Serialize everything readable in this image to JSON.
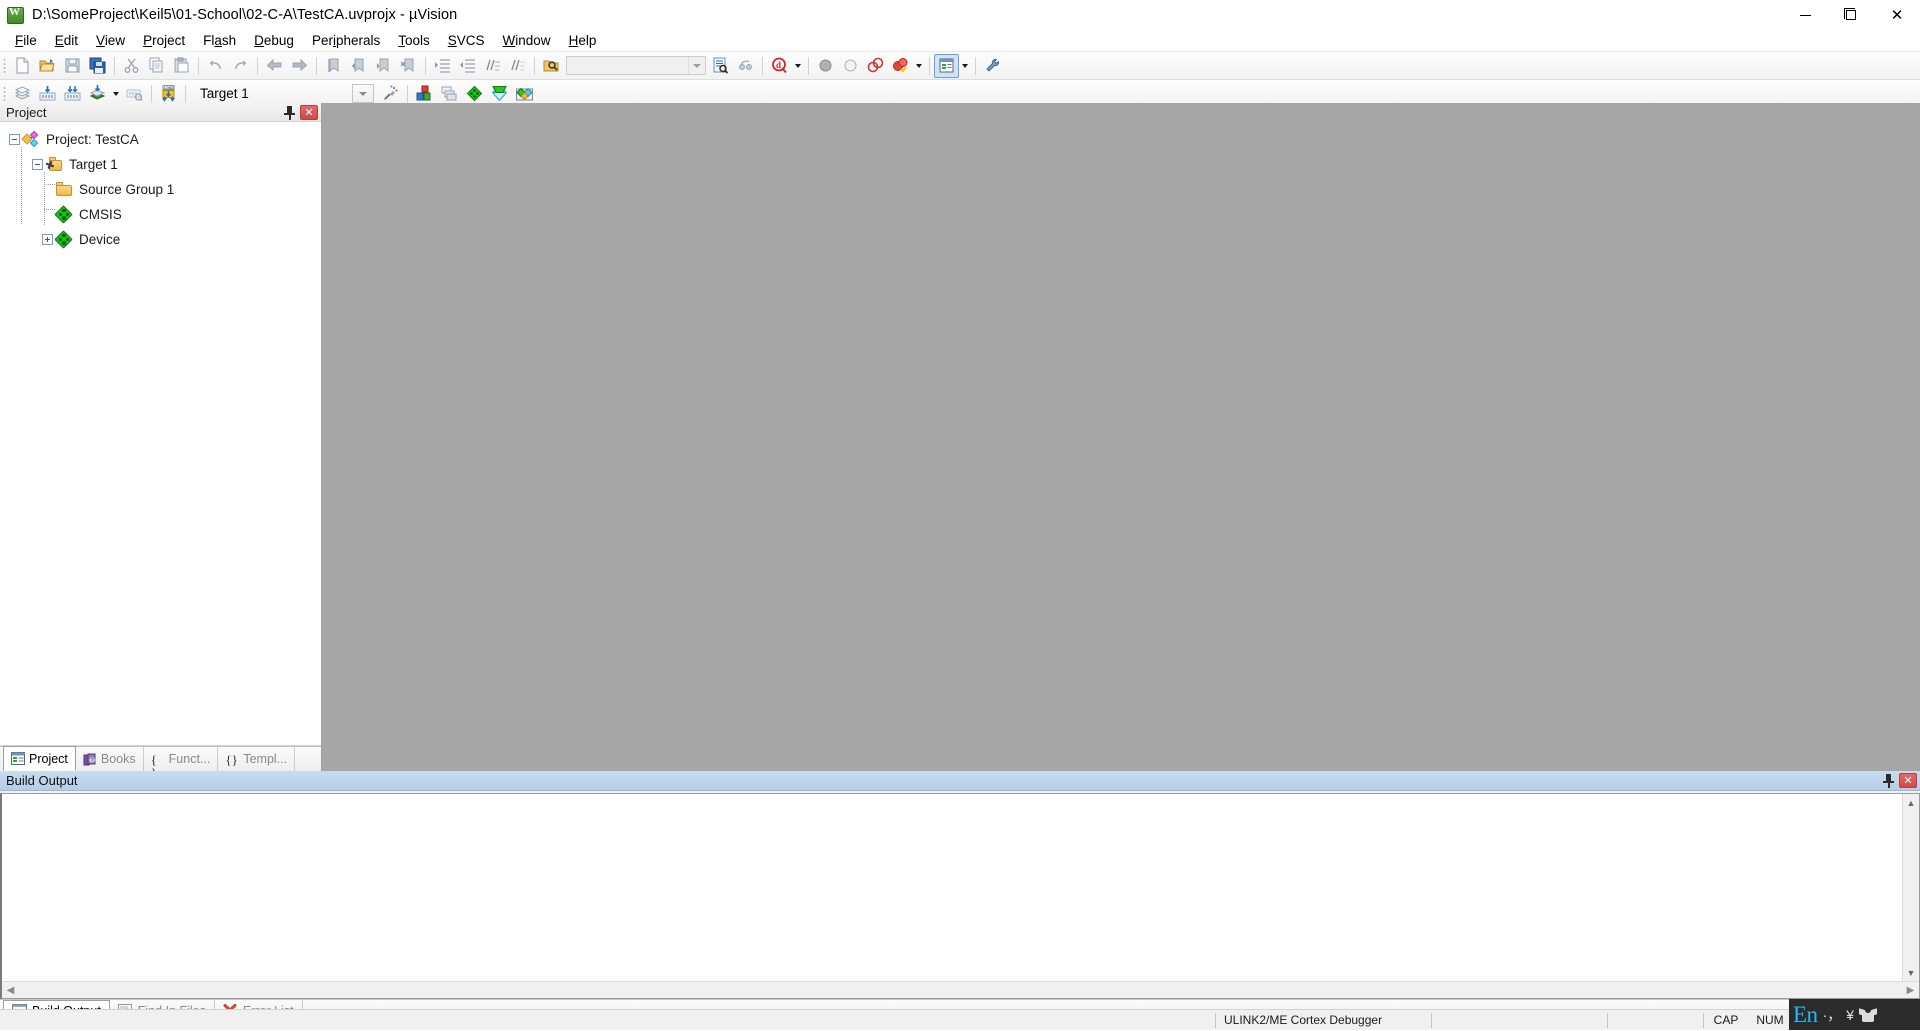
{
  "window": {
    "title": "D:\\SomeProject\\Keil5\\01-School\\02-C-A\\TestCA.uvprojx - µVision",
    "app_icon": "uvision-icon",
    "minimize_label": "Minimize",
    "maximize_label": "Maximize",
    "close_label": "Close"
  },
  "menubar": {
    "items": [
      {
        "label": "File",
        "accel": "F"
      },
      {
        "label": "Edit",
        "accel": "E"
      },
      {
        "label": "View",
        "accel": "V"
      },
      {
        "label": "Project",
        "accel": "P"
      },
      {
        "label": "Flash",
        "accel": "a"
      },
      {
        "label": "Debug",
        "accel": "D"
      },
      {
        "label": "Peripherals",
        "accel": "i"
      },
      {
        "label": "Tools",
        "accel": "T"
      },
      {
        "label": "SVCS",
        "accel": "S"
      },
      {
        "label": "Window",
        "accel": "W"
      },
      {
        "label": "Help",
        "accel": "H"
      }
    ]
  },
  "toolbar_file": {
    "buttons": [
      {
        "name": "new-file-icon",
        "tooltip": "New"
      },
      {
        "name": "open-file-icon",
        "tooltip": "Open"
      },
      {
        "name": "save-icon",
        "tooltip": "Save"
      },
      {
        "name": "save-all-icon",
        "tooltip": "Save All"
      },
      {
        "name": "cut-icon",
        "tooltip": "Cut"
      },
      {
        "name": "copy-icon",
        "tooltip": "Copy"
      },
      {
        "name": "paste-icon",
        "tooltip": "Paste"
      },
      {
        "name": "undo-icon",
        "tooltip": "Undo"
      },
      {
        "name": "redo-icon",
        "tooltip": "Redo"
      },
      {
        "name": "navigate-back-icon",
        "tooltip": "Back"
      },
      {
        "name": "navigate-forward-icon",
        "tooltip": "Forward"
      },
      {
        "name": "bookmark-toggle-icon",
        "tooltip": "Insert/Remove Bookmark"
      },
      {
        "name": "bookmark-prev-icon",
        "tooltip": "Previous Bookmark"
      },
      {
        "name": "bookmark-next-icon",
        "tooltip": "Next Bookmark"
      },
      {
        "name": "bookmark-clear-icon",
        "tooltip": "Clear All Bookmarks"
      },
      {
        "name": "indent-icon",
        "tooltip": "Indent Selected Lines"
      },
      {
        "name": "outdent-icon",
        "tooltip": "Unindent Selected Lines"
      },
      {
        "name": "comment-icon",
        "tooltip": "Comment Selection"
      },
      {
        "name": "uncomment-icon",
        "tooltip": "Uncomment Selection"
      },
      {
        "name": "find-in-files-icon",
        "tooltip": "Find in Files"
      }
    ],
    "search_box": {
      "value": "",
      "placeholder": ""
    },
    "after_search": [
      {
        "name": "find-next-icon",
        "tooltip": "Find Next"
      },
      {
        "name": "incremental-find-icon",
        "tooltip": "Incremental Find"
      },
      {
        "name": "debug-session-icon",
        "tooltip": "Start/Stop Debug Session"
      }
    ],
    "debug_buttons": [
      {
        "name": "insert-breakpoint-icon",
        "tooltip": "Insert/Remove Breakpoint"
      },
      {
        "name": "disable-breakpoint-icon",
        "tooltip": "Enable/Disable Breakpoint"
      },
      {
        "name": "disable-all-breakpoints-icon",
        "tooltip": "Disable All Breakpoints"
      },
      {
        "name": "kill-all-breakpoints-icon",
        "tooltip": "Kill All Breakpoints"
      }
    ],
    "window_button": {
      "name": "configure-toolbox-icon",
      "tooltip": "Configuration Wizard",
      "active": true
    },
    "utilities_button": {
      "name": "wrench-icon",
      "tooltip": "Utilities"
    }
  },
  "toolbar_build": {
    "buttons": [
      {
        "name": "translate-icon",
        "tooltip": "Translate"
      },
      {
        "name": "build-icon",
        "tooltip": "Build"
      },
      {
        "name": "rebuild-icon",
        "tooltip": "Rebuild"
      },
      {
        "name": "batch-build-icon",
        "tooltip": "Batch Build"
      },
      {
        "name": "stop-build-icon",
        "tooltip": "Stop Build"
      },
      {
        "name": "download-icon",
        "tooltip": "Download"
      }
    ],
    "target_value": "Target 1",
    "target_placeholder": "Select Target",
    "right_buttons": [
      {
        "name": "target-options-icon",
        "tooltip": "Options for Target"
      },
      {
        "name": "manage-project-items-icon",
        "tooltip": "Manage Project Items"
      },
      {
        "name": "manage-runtime-env-icon",
        "tooltip": "Manage Run-Time Environment"
      },
      {
        "name": "pack-installer-icon",
        "tooltip": "Pack Installer"
      },
      {
        "name": "multi-project-icon",
        "tooltip": "Manage Multi-Project Workspace"
      }
    ]
  },
  "project_panel": {
    "title": "Project",
    "pin_label": "Auto Hide",
    "close_label": "Close",
    "tree": [
      {
        "label": "Project: TestCA",
        "icon": "project-icon",
        "depth": 0,
        "expander": "minus"
      },
      {
        "label": "Target 1",
        "icon": "target-icon",
        "depth": 1,
        "expander": "minus"
      },
      {
        "label": "Source Group 1",
        "icon": "folder-icon",
        "depth": 2,
        "expander": "none"
      },
      {
        "label": "CMSIS",
        "icon": "cmsis-diamond-icon",
        "depth": 2,
        "expander": "none"
      },
      {
        "label": "Device",
        "icon": "device-diamond-icon",
        "depth": 2,
        "expander": "plus"
      }
    ],
    "tabs": [
      {
        "label": "Project",
        "icon": "project-tab-icon",
        "selected": true
      },
      {
        "label": "Books",
        "icon": "books-icon",
        "selected": false
      },
      {
        "label": "Funct...",
        "icon": "functions-icon",
        "selected": false
      },
      {
        "label": "Templ...",
        "icon": "templates-icon",
        "selected": false
      }
    ]
  },
  "build_output": {
    "title": "Build Output",
    "pin_label": "Auto Hide",
    "close_label": "Close",
    "content": ""
  },
  "bottom_tabs": [
    {
      "label": "Build Output",
      "icon": "build-output-icon",
      "selected": true
    },
    {
      "label": "Find In Files",
      "icon": "find-in-files-icon",
      "selected": false
    },
    {
      "label": "Error List",
      "icon": "error-list-icon",
      "selected": false
    }
  ],
  "statusbar": {
    "debugger": "ULINK2/ME Cortex Debugger",
    "cap": "CAP",
    "num": "NUM",
    "scrl": ""
  },
  "ime": {
    "language": "En",
    "punctuation": "·，",
    "currency": "¥",
    "toolbar_icon": "ime-skin-icon"
  },
  "colors": {
    "editor_background": "#a6a6a6",
    "panel_header_active": "#b4cde6",
    "close_button": "#cf4a4a",
    "ime_accent": "#29b6f6"
  }
}
